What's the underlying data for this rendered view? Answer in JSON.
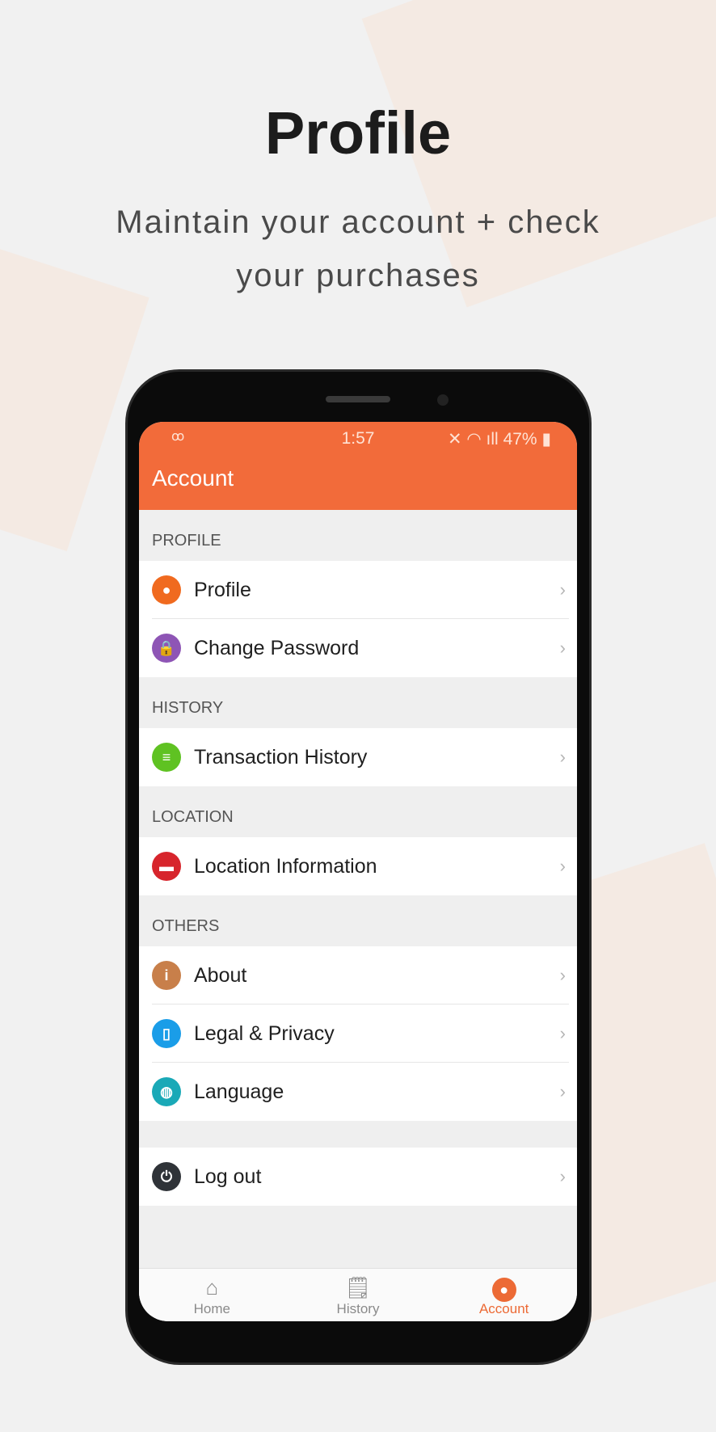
{
  "promo": {
    "title": "Profile",
    "subtitle_line1": "Maintain your account + check",
    "subtitle_line2": "your purchases"
  },
  "status_bar": {
    "time": "1:57",
    "battery": "47%",
    "left_icon": "voicemail-icon"
  },
  "header": {
    "title": "Account"
  },
  "sections": [
    {
      "label": "PROFILE",
      "items": [
        {
          "label": "Profile",
          "icon": "person-icon",
          "color": "#f06a1f"
        },
        {
          "label": "Change Password",
          "icon": "lock-reset-icon",
          "color": "#8e55b5"
        }
      ]
    },
    {
      "label": "HISTORY",
      "items": [
        {
          "label": "Transaction History",
          "icon": "document-icon",
          "color": "#5fc222"
        }
      ]
    },
    {
      "label": "LOCATION",
      "items": [
        {
          "label": "Location Information",
          "icon": "store-icon",
          "color": "#d7252c"
        }
      ]
    },
    {
      "label": "OTHERS",
      "items": [
        {
          "label": "About",
          "icon": "info-icon",
          "color": "#c87f4a"
        },
        {
          "label": "Legal & Privacy",
          "icon": "file-icon",
          "color": "#1a9de8"
        },
        {
          "label": "Language",
          "icon": "globe-icon",
          "color": "#1aa9b7"
        }
      ]
    }
  ],
  "logout": {
    "label": "Log out",
    "icon": "power-icon",
    "color": "#2f3338"
  },
  "nav": [
    {
      "label": "Home",
      "icon": "home-icon"
    },
    {
      "label": "History",
      "icon": "receipt-icon"
    },
    {
      "label": "Account",
      "icon": "account-icon",
      "active": true
    }
  ],
  "accent": "#f26b3a"
}
